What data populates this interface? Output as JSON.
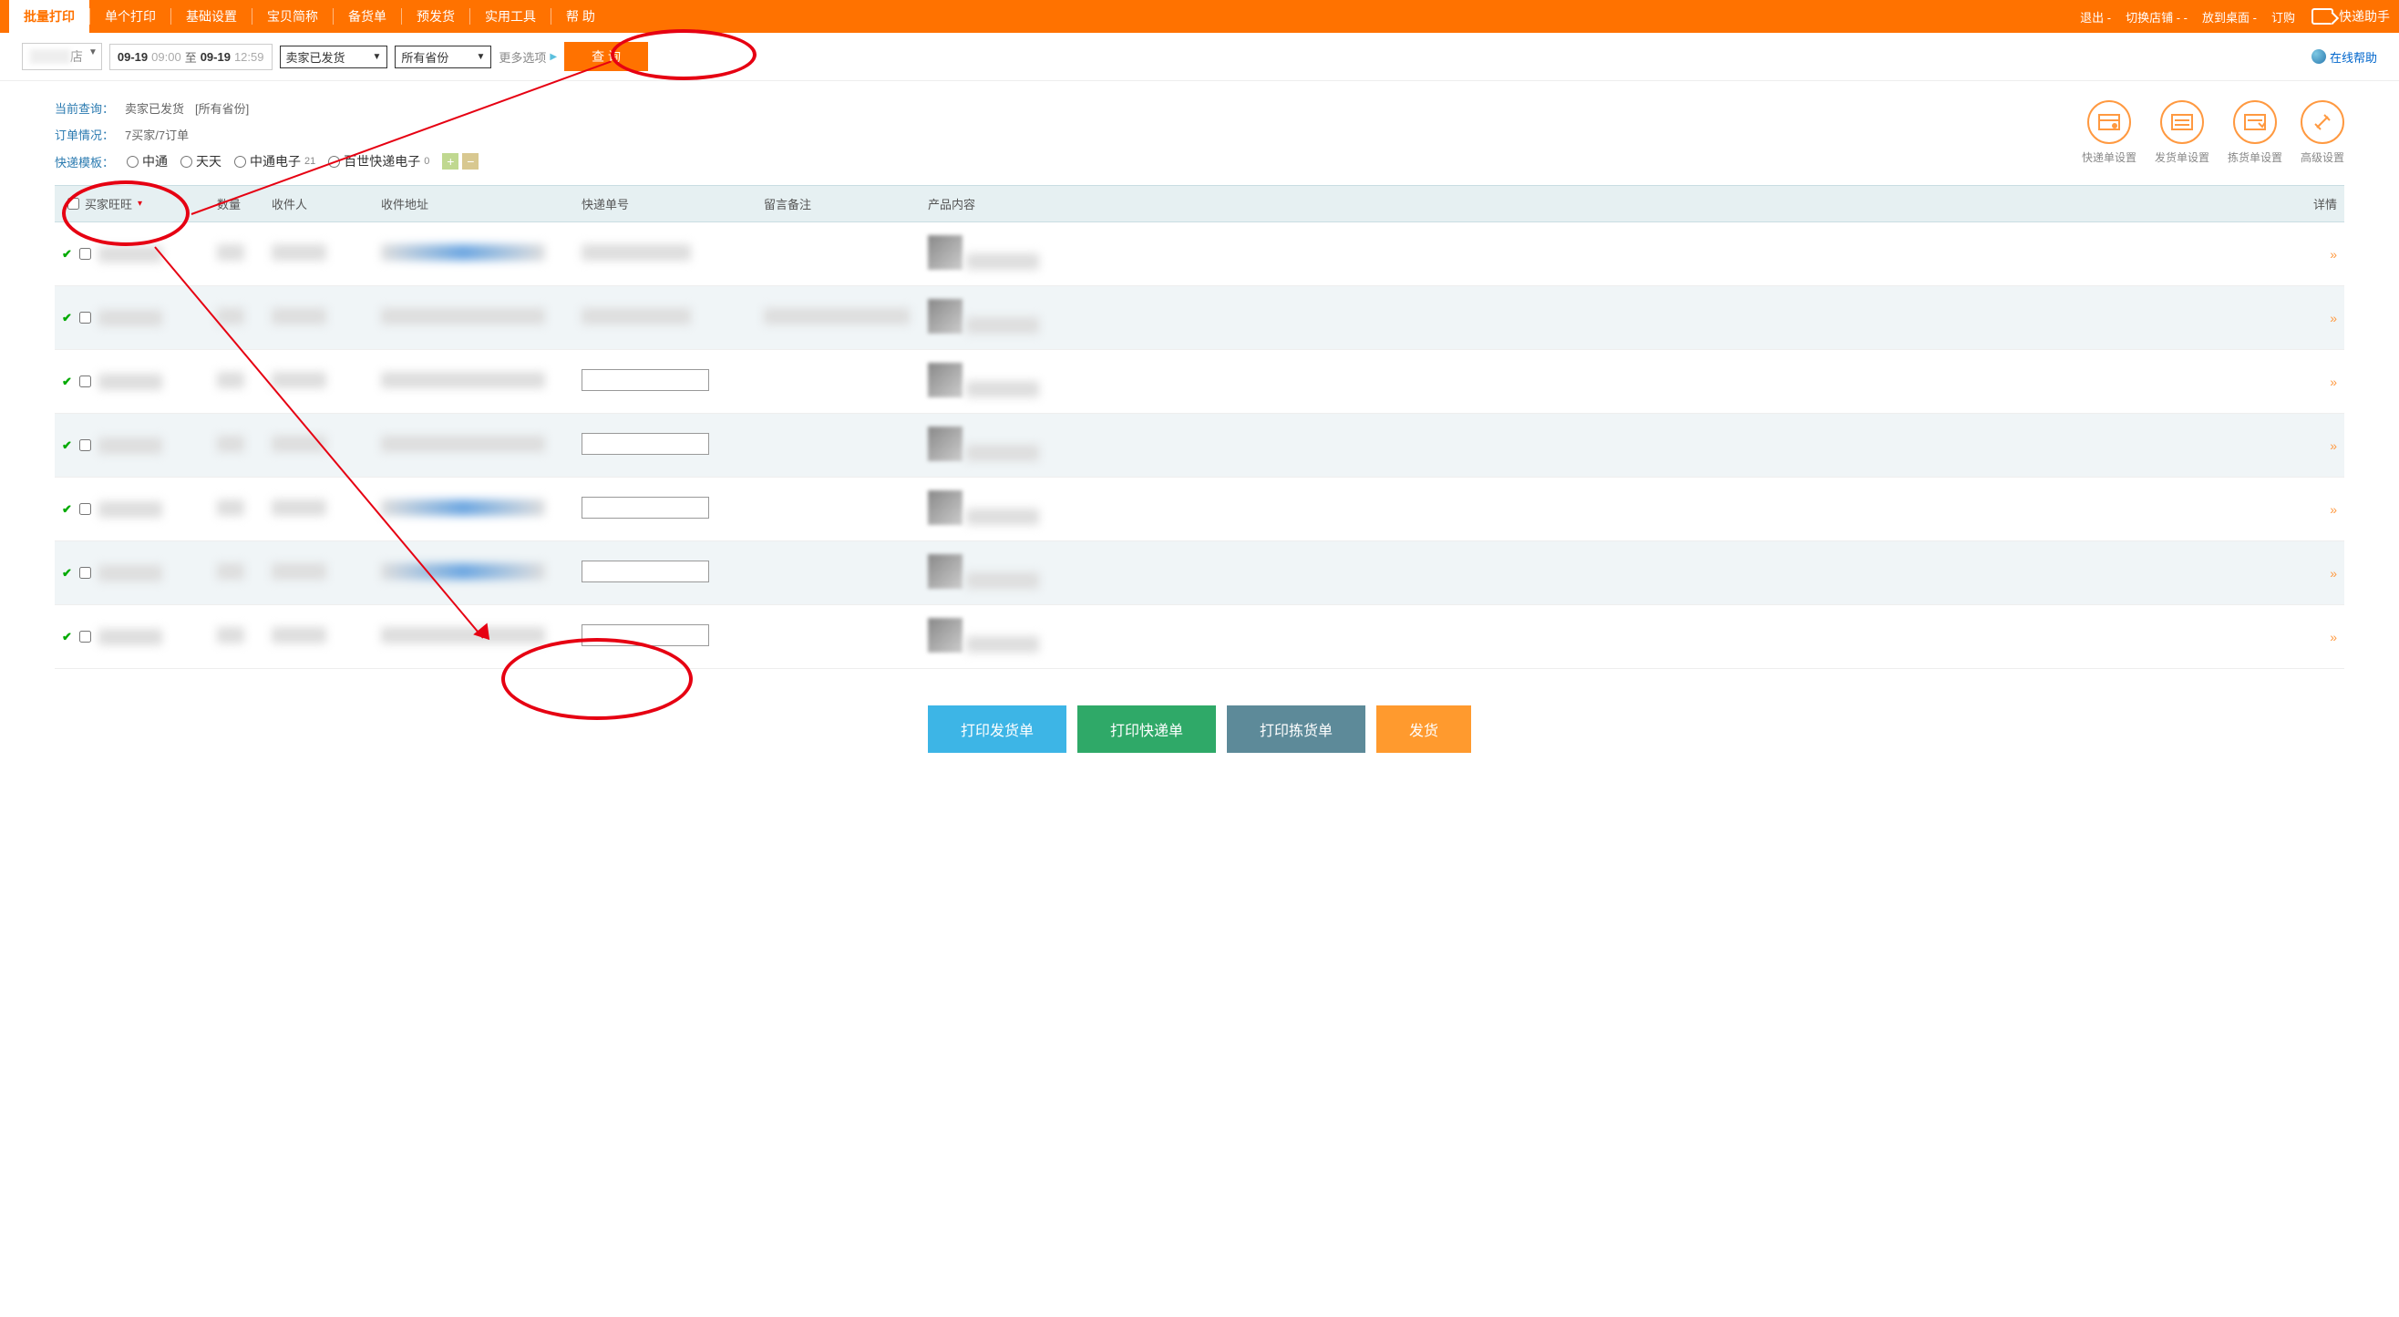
{
  "topnav": {
    "tabs": [
      "批量打印",
      "单个打印",
      "基础设置",
      "宝贝简称",
      "备货单",
      "预发货",
      "实用工具",
      "帮 助"
    ],
    "right": {
      "logout": "退出",
      "switch": "切换店铺",
      "desktop": "放到桌面",
      "subscribe": "订购",
      "brand": "快递助手"
    }
  },
  "filter": {
    "shop_placeholder": "店",
    "date1": "09-19",
    "time1": "09:00",
    "to": "至",
    "date2": "09-19",
    "time2": "12:59",
    "status": "卖家已发货",
    "province": "所有省份",
    "more": "更多选项",
    "query": "查 询",
    "help": "在线帮助"
  },
  "info": {
    "q_label": "当前查询：",
    "q_val1": "卖家已发货",
    "q_val2": "[所有省份]",
    "o_label": "订单情况：",
    "o_val": "7买家/7订单",
    "t_label": "快递模板：",
    "templates": [
      {
        "name": "中通",
        "count": ""
      },
      {
        "name": "天天",
        "count": ""
      },
      {
        "name": "中通电子",
        "count": "21"
      },
      {
        "name": "百世快递电子",
        "count": "0"
      }
    ]
  },
  "config": [
    {
      "id": "express",
      "label": "快递单设置"
    },
    {
      "id": "dispatch",
      "label": "发货单设置"
    },
    {
      "id": "pick",
      "label": "拣货单设置"
    },
    {
      "id": "adv",
      "label": "高级设置"
    }
  ],
  "table": {
    "cols": {
      "c1": "买家旺旺",
      "c2": "数量",
      "c3": "收件人",
      "c4": "收件地址",
      "c5": "快递单号",
      "c6": "留言备注",
      "c7": "产品内容",
      "c8": "详情"
    },
    "rows": [
      {
        "expand": "»"
      },
      {
        "expand": "»"
      },
      {
        "expand": "»"
      },
      {
        "expand": "»"
      },
      {
        "expand": "»"
      },
      {
        "expand": "»"
      },
      {
        "expand": "»"
      }
    ]
  },
  "actions": {
    "b1": "打印发货单",
    "b2": "打印快递单",
    "b3": "打印拣货单",
    "b4": "发货"
  }
}
